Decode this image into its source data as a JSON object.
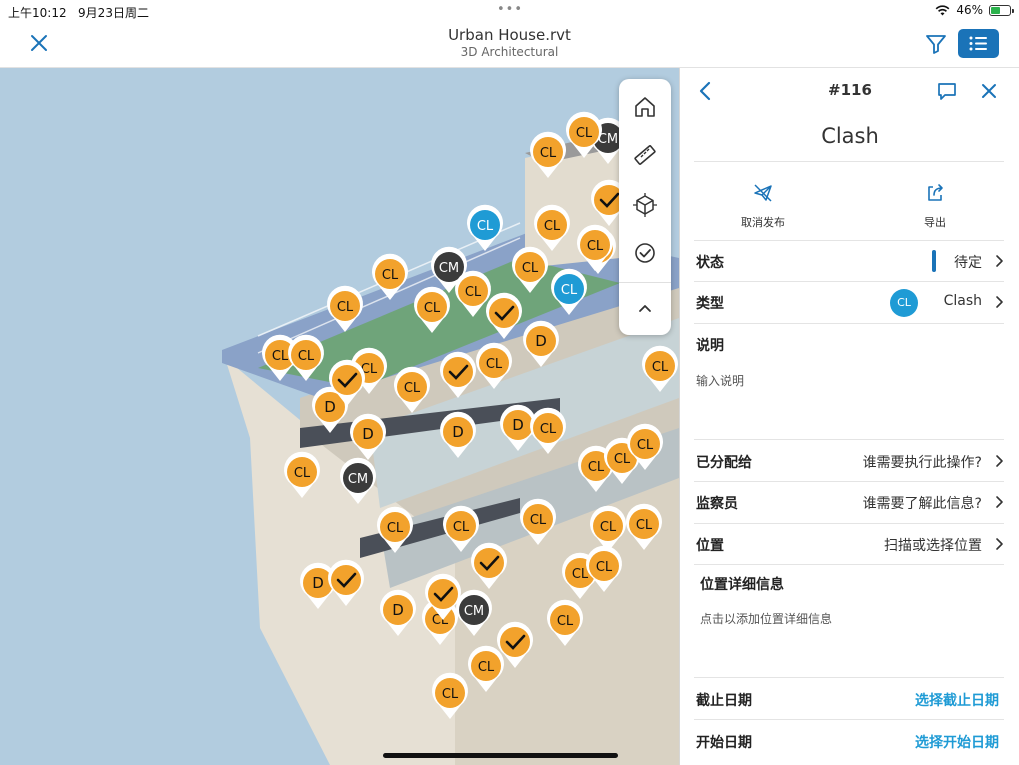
{
  "status_bar": {
    "time": "上午10:12",
    "date": "9月23日周二",
    "multitask_dots": "•••",
    "battery_percent": "46%",
    "battery_level": 0.46
  },
  "nav": {
    "title": "Urban House.rvt",
    "subtitle": "3D Architectural",
    "icons": [
      "close-icon",
      "filter-icon",
      "list-icon"
    ]
  },
  "viewer": {
    "toolbar_icons": [
      "home-icon",
      "measure-icon",
      "section-box-icon",
      "check-circle-icon",
      "chevron-up-icon"
    ],
    "pin_colors": {
      "clash": "#f2a22c",
      "comment": "#3b3b3b",
      "selected": "#1f9bd5",
      "border": "#ffffff"
    },
    "pins": [
      {
        "label": "CL",
        "kind": "clash"
      },
      {
        "label": "CM",
        "kind": "comment"
      },
      {
        "label": "CL",
        "kind": "clash"
      },
      {
        "label": "CL",
        "kind": "clash"
      },
      {
        "label": "CL",
        "kind": "selected"
      },
      {
        "label": "CL",
        "kind": "clash"
      },
      {
        "label": "CL",
        "kind": "clash"
      },
      {
        "label": "CL",
        "kind": "clash"
      },
      {
        "label": "CM",
        "kind": "comment"
      },
      {
        "label": "CL",
        "kind": "clash"
      },
      {
        "label": "CL",
        "kind": "selected"
      },
      {
        "label": "CL",
        "kind": "clash"
      },
      {
        "label": "CL",
        "kind": "clash"
      },
      {
        "label": "CL",
        "kind": "clash"
      },
      {
        "label": "D",
        "kind": "clash"
      },
      {
        "label": "CL",
        "kind": "clash"
      },
      {
        "label": "CL",
        "kind": "clash"
      },
      {
        "label": "CL",
        "kind": "clash"
      },
      {
        "label": "D",
        "kind": "clash"
      },
      {
        "label": "D",
        "kind": "clash"
      },
      {
        "label": "D",
        "kind": "clash"
      },
      {
        "label": "D",
        "kind": "clash"
      },
      {
        "label": "CL",
        "kind": "clash"
      },
      {
        "label": "CL",
        "kind": "clash"
      },
      {
        "label": "CL",
        "kind": "clash"
      },
      {
        "label": "CM",
        "kind": "comment"
      },
      {
        "label": "CL",
        "kind": "clash"
      },
      {
        "label": "CL",
        "kind": "clash"
      },
      {
        "label": "CL",
        "kind": "clash"
      },
      {
        "label": "CL",
        "kind": "clash"
      },
      {
        "label": "CL",
        "kind": "clash"
      },
      {
        "label": "CL",
        "kind": "clash"
      },
      {
        "label": "D",
        "kind": "clash"
      },
      {
        "label": "CL",
        "kind": "clash"
      },
      {
        "label": "CM",
        "kind": "comment"
      },
      {
        "label": "CL",
        "kind": "clash"
      },
      {
        "label": "CL",
        "kind": "clash"
      },
      {
        "label": "CL",
        "kind": "clash"
      },
      {
        "label": "CL",
        "kind": "clash"
      },
      {
        "label": "CL",
        "kind": "clash"
      },
      {
        "label": "CL",
        "kind": "clash"
      },
      {
        "label": "D",
        "kind": "clash"
      },
      {
        "label": "CL",
        "kind": "clash"
      },
      {
        "label": "CL",
        "kind": "clash"
      },
      {
        "label": "CL",
        "kind": "clash"
      },
      {
        "label": "",
        "kind": "clash-check"
      },
      {
        "label": "",
        "kind": "clash-check"
      },
      {
        "label": "",
        "kind": "clash-check"
      },
      {
        "label": "",
        "kind": "clash-check"
      },
      {
        "label": "",
        "kind": "clash-check"
      },
      {
        "label": "",
        "kind": "clash-check"
      },
      {
        "label": "",
        "kind": "clash-check"
      },
      {
        "label": "",
        "kind": "clash-check"
      }
    ]
  },
  "panel": {
    "issue_number": "#116",
    "heading": "Clash",
    "actions": [
      {
        "label": "取消发布",
        "icon": "unpublish-icon"
      },
      {
        "label": "导出",
        "icon": "export-icon"
      }
    ],
    "status": {
      "label": "状态",
      "value": "待定"
    },
    "type": {
      "label": "类型",
      "badge": "CL",
      "value": "Clash"
    },
    "description": {
      "label": "说明",
      "placeholder": "输入说明"
    },
    "assigned_to": {
      "label": "已分配给",
      "value": "谁需要执行此操作?"
    },
    "watchers": {
      "label": "监察员",
      "value": "谁需要了解此信息?"
    },
    "location": {
      "label": "位置",
      "value": "扫描或选择位置"
    },
    "location_details": {
      "label": "位置详细信息",
      "placeholder": "点击以添加位置详细信息"
    },
    "due_date": {
      "label": "截止日期",
      "action": "选择截止日期"
    },
    "start_date": {
      "label": "开始日期",
      "action": "选择开始日期"
    },
    "accent": "#1a73b8",
    "link_color": "#1f9bd5"
  }
}
